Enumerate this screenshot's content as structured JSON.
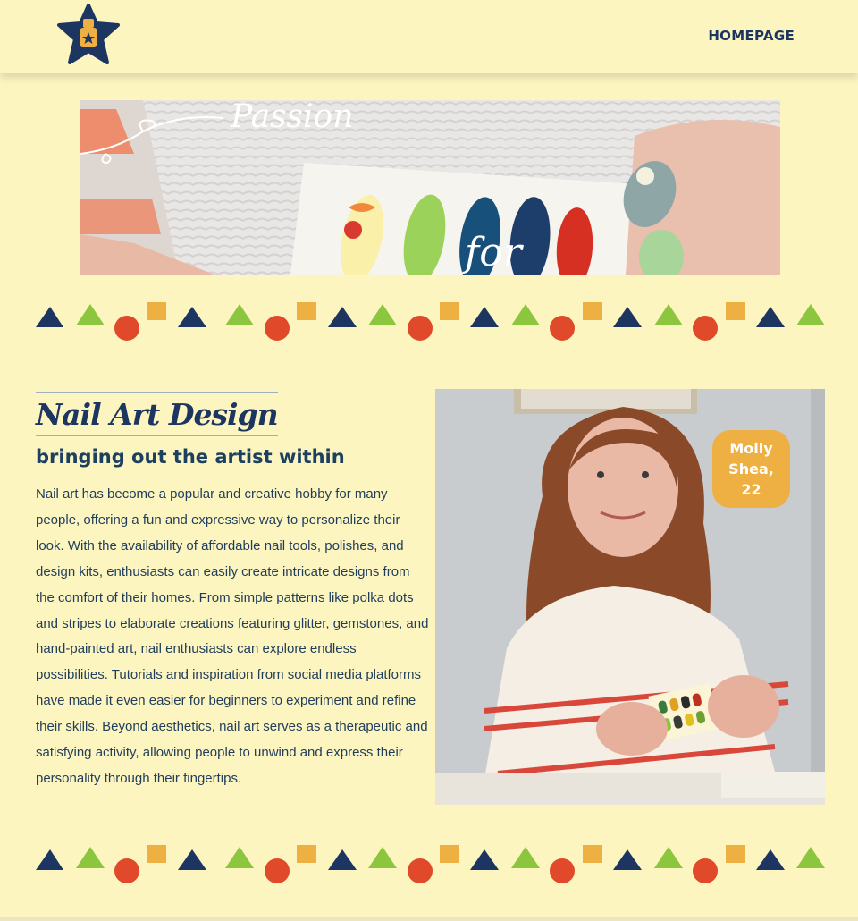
{
  "nav": {
    "homepage_label": "HOMEPAGE"
  },
  "logo": {
    "icon": "nail-polish-star-icon"
  },
  "hero": {
    "script_word_1": "Passion",
    "script_word_2": "for"
  },
  "article": {
    "title": "Nail Art Design",
    "subtitle": "bringing out the artist within",
    "body": "Nail art has become a popular and creative hobby for many people, offering a fun and expressive way to personalize their look. With the availability of affordable nail tools, polishes, and design kits, enthusiasts can easily create intricate designs from the comfort of their homes. From simple patterns like polka dots and stripes to elaborate creations featuring glitter, gemstones, and hand-painted art, nail enthusiasts can explore endless possibilities. Tutorials and inspiration from social media platforms have made it even easier for beginners to experiment and refine their skills. Beyond aesthetics, nail art serves as a therapeutic and satisfying activity, allowing people to unwind and express their personality through their fingertips."
  },
  "portrait": {
    "caption": "Molly Shea, 22"
  },
  "colors": {
    "background": "#fdf5bf",
    "navy": "#1c3561",
    "green": "#8cc63f",
    "red": "#e04a2a",
    "yellow": "#eeb042"
  }
}
